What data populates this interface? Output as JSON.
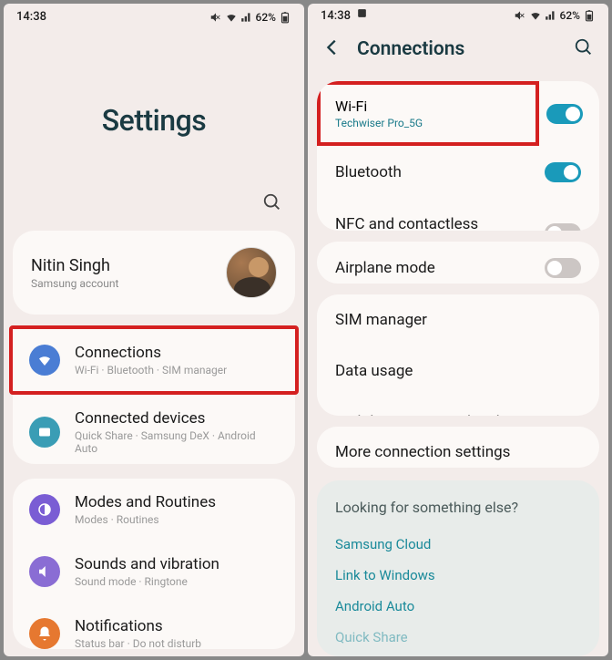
{
  "statusbar": {
    "time": "14:38",
    "battery": "62%"
  },
  "left": {
    "title": "Settings",
    "account": {
      "name": "Nitin Singh",
      "sub": "Samsung account"
    },
    "group1": [
      {
        "title": "Connections",
        "sub": "Wi-Fi · Bluetooth · SIM manager"
      },
      {
        "title": "Connected devices",
        "sub": "Quick Share · Samsung DeX · Android Auto"
      }
    ],
    "group2": [
      {
        "title": "Modes and Routines",
        "sub": "Modes · Routines"
      },
      {
        "title": "Sounds and vibration",
        "sub": "Sound mode · Ringtone"
      },
      {
        "title": "Notifications",
        "sub": "Status bar · Do not disturb"
      }
    ]
  },
  "right": {
    "header": "Connections",
    "wifi": {
      "title": "Wi-Fi",
      "sub": "Techwiser Pro_5G"
    },
    "card1": [
      {
        "title": "Bluetooth",
        "toggle": "on"
      },
      {
        "title": "NFC and contactless payments",
        "toggle": "off"
      }
    ],
    "airplane": {
      "title": "Airplane mode",
      "toggle": "off"
    },
    "card3": [
      {
        "title": "SIM manager"
      },
      {
        "title": "Data usage"
      },
      {
        "title": "Mobile Hotspot and Tethering"
      }
    ],
    "more": {
      "title": "More connection settings"
    },
    "looking": {
      "title": "Looking for something else?",
      "links": [
        "Samsung Cloud",
        "Link to Windows",
        "Android Auto",
        "Quick Share"
      ]
    }
  }
}
